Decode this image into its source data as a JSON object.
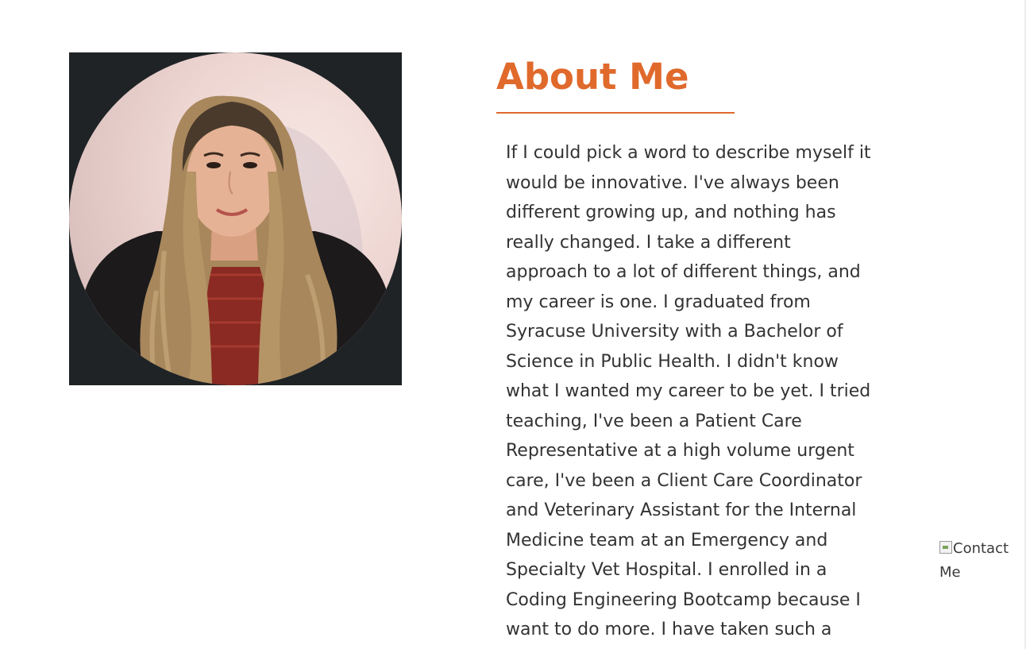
{
  "about": {
    "title": "About Me",
    "bio": "If I could pick a word to describe myself it would be innovative. I've always been different growing up, and nothing has really changed. I take a different approach to a lot of different things, and my career is one. I graduated from Syracuse University with a Bachelor of Science in Public Health. I didn't know what I wanted my career to be yet. I tried teaching, I've been a Patient Care Representative at a high volume urgent care, I've been a Client Care Coordinator and Veterinary Assistant for the Internal Medicine team at an Emergency and Specialty Vet Hospital. I enrolled in a Coding Engineering Bootcamp because I want to do more. I have taken such a"
  },
  "contact": {
    "alt_text": "Contact Me"
  },
  "colors": {
    "accent": "#e0692c",
    "body_text": "#333333",
    "photo_background": "#1f2326"
  },
  "icons": {
    "contact": "broken-image-icon"
  }
}
